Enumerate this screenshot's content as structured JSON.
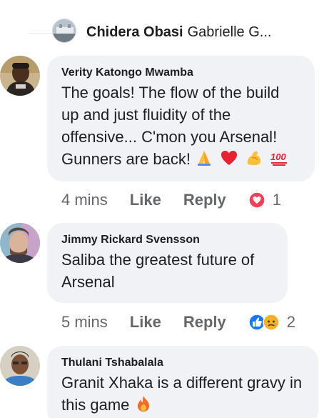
{
  "thread": {
    "bold_name": "Chidera Obasi",
    "second_name": "Gabrielle G..."
  },
  "comments": [
    {
      "author": "Verity Katongo Mwamba",
      "text": "The goals! The flow of the build up and just  fluidity of the offensive... C'mon you Arsenal! Gunners are back!",
      "time": "4 mins",
      "like": "Like",
      "reply": "Reply",
      "reaction_count": "1",
      "emojis": [
        "folded-hands",
        "red-heart",
        "flexed-biceps",
        "hundred-points"
      ]
    },
    {
      "author": "Jimmy Rickard Svensson",
      "text": "Saliba the greatest future of Arsenal",
      "time": "5 mins",
      "like": "Like",
      "reply": "Reply",
      "reaction_count": "2"
    },
    {
      "author": "Thulani Tshabalala",
      "text": "Granit Xhaka is a different gravy in this game"
    }
  ],
  "colors": {
    "bubble": "#f0f2f5",
    "meta_text": "#65676b",
    "love": "#f33e58",
    "like": "#1877f2",
    "sad": "#f7b125"
  }
}
